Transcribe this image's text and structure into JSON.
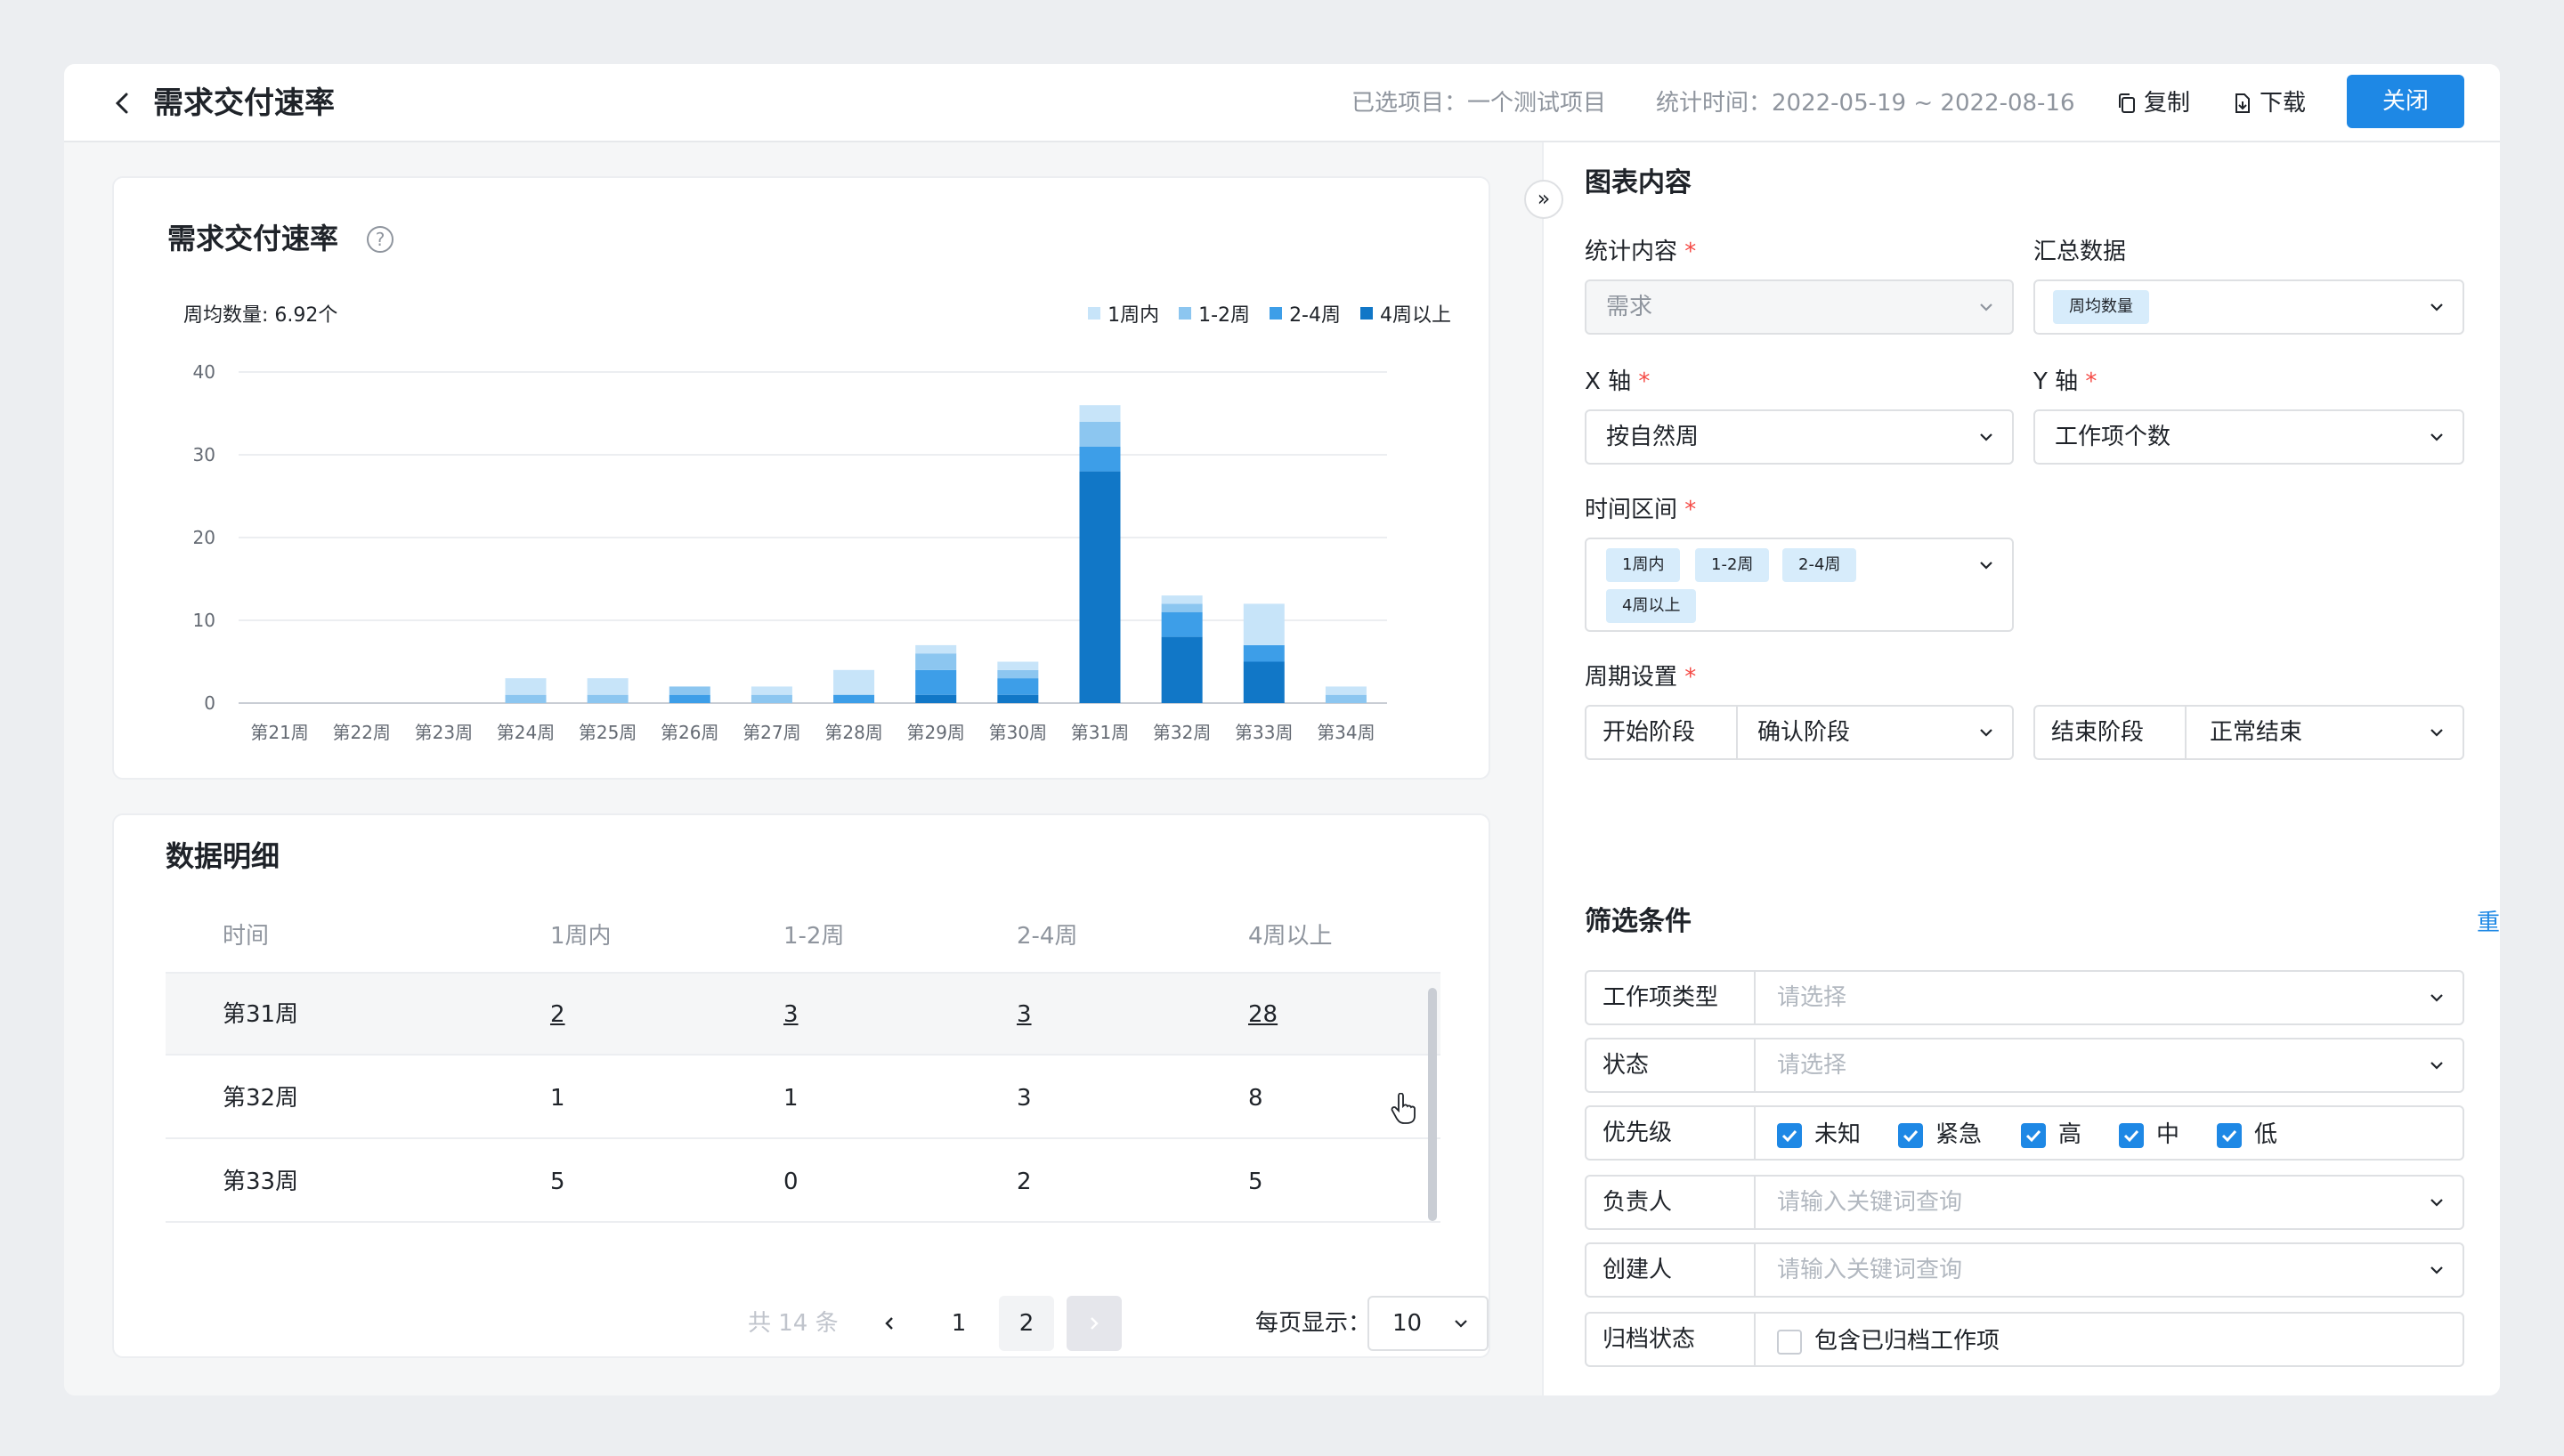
{
  "header": {
    "title": "需求交付速率",
    "project": "已选项目：一个测试项目",
    "period": "统计时间：2022-05-19 ~ 2022-08-16",
    "copy": "复制",
    "download": "下载",
    "close": "关闭"
  },
  "chart_card": {
    "title": "需求交付速率",
    "help": "?",
    "avg": "周均数量: 6.92个"
  },
  "chart_data": {
    "type": "bar",
    "stacked": true,
    "categories": [
      "第21周",
      "第22周",
      "第23周",
      "第24周",
      "第25周",
      "第26周",
      "第27周",
      "第28周",
      "第29周",
      "第30周",
      "第31周",
      "第32周",
      "第33周",
      "第34周"
    ],
    "series": [
      {
        "name": "4周以上",
        "color": "#1177c7",
        "values": [
          0,
          0,
          0,
          0,
          0,
          0,
          0,
          0,
          1,
          1,
          28,
          8,
          5,
          0
        ]
      },
      {
        "name": "2-4周",
        "color": "#3d9ee8",
        "values": [
          0,
          0,
          0,
          0,
          0,
          1,
          0,
          1,
          3,
          2,
          3,
          3,
          2,
          0
        ]
      },
      {
        "name": "1-2周",
        "color": "#8cc6f0",
        "values": [
          0,
          0,
          0,
          1,
          1,
          1,
          1,
          0,
          2,
          1,
          3,
          1,
          0,
          1
        ]
      },
      {
        "name": "1周内",
        "color": "#c7e4f9",
        "values": [
          0,
          0,
          0,
          2,
          2,
          0,
          1,
          3,
          1,
          1,
          2,
          1,
          5,
          1
        ]
      }
    ],
    "legend_order": [
      "1周内",
      "1-2周",
      "2-4周",
      "4周以上"
    ],
    "yticks": [
      "0",
      "10",
      "20",
      "30",
      "40"
    ],
    "ylim": [
      0,
      40
    ],
    "legend_position": "top-right",
    "grid": true
  },
  "detail": {
    "title": "数据明细",
    "columns": [
      "时间",
      "1周内",
      "1-2周",
      "2-4周",
      "4周以上"
    ],
    "rows": [
      [
        "第31周",
        "2",
        "3",
        "3",
        "28"
      ],
      [
        "第32周",
        "1",
        "1",
        "3",
        "8"
      ],
      [
        "第33周",
        "5",
        "0",
        "2",
        "5"
      ]
    ],
    "total": "共 14 条",
    "page1": "1",
    "page2": "2",
    "per_page_label": "每页显示：",
    "per_page": "10"
  },
  "panel": {
    "section_title": "图表内容",
    "stat_label": "统计内容",
    "stat_value": "需求",
    "summary_label": "汇总数据",
    "summary_tag": "周均数量",
    "x_label": "X 轴",
    "x_value": "按自然周",
    "y_label": "Y 轴",
    "y_value": "工作项个数",
    "range_label": "时间区间",
    "range_tags": [
      "1周内",
      "1-2周",
      "2-4周",
      "4周以上"
    ],
    "cycle_label": "周期设置",
    "start_key": "开始阶段",
    "start_value": "确认阶段",
    "end_key": "结束阶段",
    "end_value": "正常结束",
    "filter_title": "筛选条件",
    "reset": "重置条件",
    "filters": {
      "type_key": "工作项类型",
      "type_ph": "请选择",
      "status_key": "状态",
      "status_ph": "请选择",
      "priority_key": "优先级",
      "priorities": [
        "未知",
        "紧急",
        "高",
        "中",
        "低"
      ],
      "owner_key": "负责人",
      "owner_ph": "请输入关键词查询",
      "creator_key": "创建人",
      "creator_ph": "请输入关键词查询",
      "archive_key": "归档状态",
      "archive_option": "包含已归档工作项"
    }
  },
  "colors": {
    "accent": "#1e88e5",
    "required": "#f54a45"
  }
}
